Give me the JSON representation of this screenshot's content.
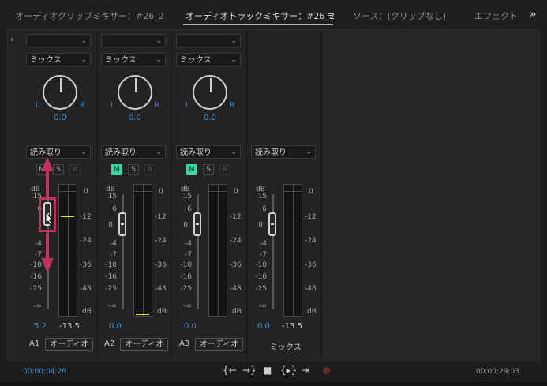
{
  "tabs": [
    {
      "label": "オーディオクリップミキサー：#26_2",
      "active": false
    },
    {
      "label": "オーディオトラックミキサー：#26_2",
      "active": true
    },
    {
      "label": "ソース：(クリップなし)",
      "active": false
    },
    {
      "label": "エフェクト",
      "active": false
    }
  ],
  "panel_menu_icon": "≡",
  "more_tabs_icon": "»",
  "collapse_icon": "›",
  "tracks": [
    {
      "id": "A1",
      "name": "オーディオ",
      "mode": "ミックス",
      "automation": "読み取り",
      "pan": "0.0",
      "knob_l": "L",
      "knob_r": "R",
      "volume": "5.2",
      "meter_reading": "-13.5",
      "m_active": false,
      "m": "M",
      "s": "S",
      "r": "R"
    },
    {
      "id": "A2",
      "name": "オーディオ",
      "mode": "ミックス",
      "automation": "読み取り",
      "pan": "0.0",
      "knob_l": "L",
      "knob_r": "R",
      "volume": "0.0",
      "meter_reading": "",
      "m_active": true,
      "m": "M",
      "s": "S",
      "r": "R"
    },
    {
      "id": "A3",
      "name": "オーディオ",
      "mode": "ミックス",
      "automation": "読み取り",
      "pan": "0.0",
      "knob_l": "L",
      "knob_r": "R",
      "volume": "0.0",
      "meter_reading": "",
      "m_active": true,
      "m": "M",
      "s": "S",
      "r": "R"
    }
  ],
  "master": {
    "name": "ミックス",
    "automation": "読み取り",
    "volume": "0.0",
    "meter_reading": "-13.5"
  },
  "fader_scale": {
    "unit": "dB",
    "labels": [
      "15",
      "6",
      "0",
      "-4",
      "-7",
      "-10",
      "-16",
      "-25",
      "-∞"
    ]
  },
  "fader_scale_a1": {
    "unit": "dB",
    "labels": [
      "15",
      "6",
      "0",
      "-4",
      "-7",
      "-10",
      "-16",
      "-25",
      "-∞"
    ]
  },
  "meter_scale": {
    "labels": [
      "0",
      "-12",
      "-24",
      "-36",
      "-48"
    ],
    "unit": "dB"
  },
  "transport": {
    "timecode_left": "00;00;04;26",
    "timecode_right": "00;00;29;03",
    "go_in": "{←",
    "go_out": "→}",
    "stop": "■",
    "loop": "{▸}",
    "export": "⇥"
  },
  "icons": {
    "chevron": "⌄",
    "colors": {
      "accent": "#3d8fd6",
      "mute_on": "#3ad6a3",
      "peak": "#e8e24a",
      "annotation": "#c0335a"
    }
  }
}
